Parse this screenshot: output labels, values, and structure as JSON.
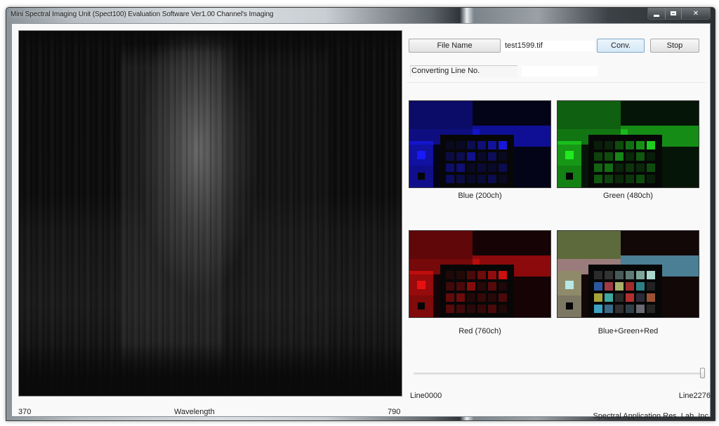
{
  "window": {
    "title": "Mini Spectral Imaging Unit (Spect100) Evaluation Software Ver1.00 Channel's Imaging",
    "controls": [
      "minimize-icon",
      "maximize-icon",
      "close-icon"
    ]
  },
  "spectral_view": {
    "axis_min": "370",
    "axis_label": "Wavelength",
    "axis_max": "790"
  },
  "toolbar": {
    "file_name_button": "File Name",
    "file_name_value": "test1599.tif",
    "convert_button": "Conv.",
    "stop_button": "Stop",
    "converting_line_label": "Converting Line No.",
    "converting_line_value": ""
  },
  "channels": [
    {
      "caption": "Blue (200ch)",
      "tint": "#1a1aff"
    },
    {
      "caption": "Green (480ch)",
      "tint": "#22ee22"
    },
    {
      "caption": "Red (760ch)",
      "tint": "#ee1111"
    },
    {
      "caption": "Blue+Green+Red",
      "tint": "composite"
    }
  ],
  "line_slider": {
    "min_label": "Line0000",
    "max_label": "Line2276",
    "position_fraction": 1.0
  },
  "footer": {
    "company": "Spectral Application Res. Lab. Inc."
  }
}
